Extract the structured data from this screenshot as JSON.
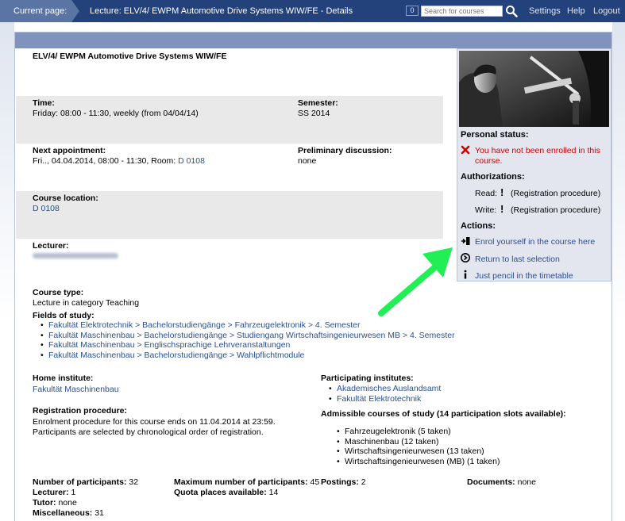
{
  "topbar": {
    "current_page_label": "Current page:",
    "title": "Lecture: ELV/4/ EWPM Automotive Drive Systems WIW/FE - Details",
    "badge": "0",
    "search_placeholder": "Search for courses",
    "settings": "Settings",
    "help": "Help",
    "logout": "Logout"
  },
  "course": {
    "name": "ELV/4/ EWPM Automotive Drive Systems WIW/FE",
    "time_label": "Time:",
    "time_value": "Friday: 08:00 - 11:30, weekly (from 04/04/14)",
    "semester_label": "Semester:",
    "semester_value": "SS 2014",
    "next_label": "Next appointment:",
    "next_value": "Fri.., 04.04.2014, 08:00 - 11:30, Room:",
    "next_room": "D 0108",
    "prelim_label": "Preliminary discussion:",
    "prelim_value": "none",
    "location_label": "Course location:",
    "location_value": "D 0108",
    "lecturer_label": "Lecturer:",
    "type_label": "Course type:",
    "type_value": "Lecture in category Teaching",
    "fields_label": "Fields of study:",
    "fields": [
      "Fakultät Elektrotechnik > Bachelorstudiengänge > Fahrzeugelektronik > 4. Semester",
      "Fakultät Maschinenbau > Bachelorstudiengänge > Studiengang Wirtschaftsingenieurwesen MB > 4. Semester",
      "Fakultät Maschinenbau > Englischsprachige Lehrveranstaltungen",
      "Fakultät Maschinenbau > Bachelorstudiengänge > Wahlpflichtmodule"
    ],
    "home_label": "Home institute:",
    "home_value": "Fakultät Maschinenbau",
    "participating_label": "Participating institutes:",
    "participating": [
      "Akademisches Auslandsamt",
      "Fakultät Elektrotechnik"
    ],
    "registration_label": "Registration procedure:",
    "registration_line1": "Enrolment procedure for this course ends on 11.04.2014 at 23:59.",
    "registration_line2": "Participants are selected by chronological order of registration.",
    "admissible_label": "Admissible courses of study (14 participation slots available):",
    "admissible": [
      "Fahrzeugelektronik   (5 taken)",
      "Maschinenbau   (12 taken)",
      "Wirtschaftsingenieurwesen   (13 taken)",
      "Wirtschaftsingenieurwesen (MB)   (1 taken)"
    ]
  },
  "stats": {
    "participants_label": "Number of participants:",
    "participants_value": "32",
    "lecturer_label": "Lecturer:",
    "lecturer_value": "1",
    "tutor_label": "Tutor:",
    "tutor_value": "none",
    "misc_label": "Miscellaneous:",
    "misc_value": "31",
    "max_label": "Maximum number of participants:",
    "max_value": "45",
    "quota_label": "Quota places available:",
    "quota_value": "14",
    "postings_label": "Postings:",
    "postings_value": "2",
    "documents_label": "Documents:",
    "documents_value": "none"
  },
  "sidebar": {
    "personal_status": "Personal status:",
    "not_enrolled_1": "You have not been enrolled in this",
    "not_enrolled_2": "course.",
    "authorizations": "Authorizations:",
    "read_label": "Read:",
    "read_value": "(Registration procedure)",
    "write_label": "Write:",
    "write_value": "(Registration procedure)",
    "actions": "Actions:",
    "enrol": "Enrol yourself in the course here",
    "return": "Return to last selection",
    "pencil": "Just pencil in the timetable"
  },
  "colors": {
    "topbar": "#23427b",
    "link": "#2a4f91",
    "error": "#cc0000",
    "arrow": "#22ee55"
  }
}
